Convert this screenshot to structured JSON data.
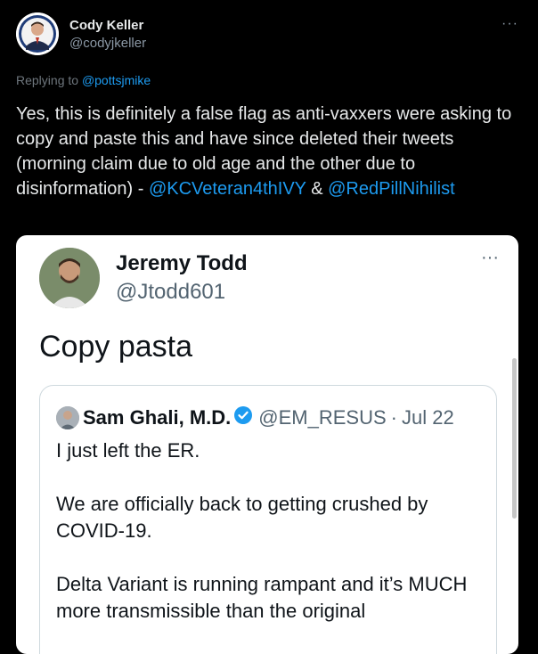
{
  "author": {
    "name": "Cody Keller",
    "handle": "@codyjkeller",
    "more": "···"
  },
  "reply": {
    "prefix": "Replying to ",
    "to": "@pottsjmike"
  },
  "tweet": {
    "text_main": "Yes, this is definitely a false flag as anti-vaxxers were asking to copy and paste this and have since deleted their tweets (morning claim due to old age and the other due to disinformation) - ",
    "mention_1": "@KCVeteran4thIVY",
    "and": " & ",
    "mention_2": "@RedPillNihilist"
  },
  "embedded": {
    "name": "Jeremy Todd",
    "handle": "@Jtodd601",
    "more": "···",
    "text": "Copy pasta",
    "quote": {
      "name": "Sam Ghali, M.D.",
      "handle": "@EM_RESUS",
      "separator": "·",
      "date": "Jul 22",
      "paragraphs": [
        "I just left the ER.",
        "We are officially back to getting crushed by COVID-19.",
        "Delta Variant is running rampant and it’s MUCH more transmissible than the original"
      ]
    }
  },
  "colors": {
    "link": "#1d9bf0",
    "background": "#000000",
    "verified": "#1d9bf0"
  }
}
